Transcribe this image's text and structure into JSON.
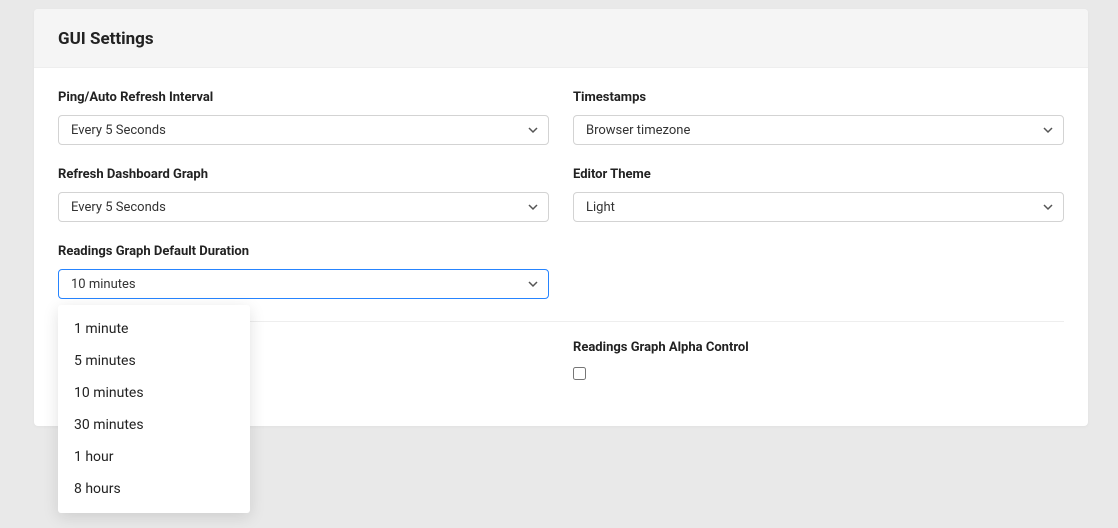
{
  "header": {
    "title": "GUI Settings"
  },
  "fields": {
    "ping_interval": {
      "label": "Ping/Auto Refresh Interval",
      "value": "Every 5 Seconds"
    },
    "refresh_graph": {
      "label": "Refresh Dashboard Graph",
      "value": "Every 5 Seconds"
    },
    "readings_duration": {
      "label": "Readings Graph Default Duration",
      "value": "10 minutes"
    },
    "timestamps": {
      "label": "Timestamps",
      "value": "Browser timezone"
    },
    "editor_theme": {
      "label": "Editor Theme",
      "value": "Light"
    }
  },
  "readings_duration_options": [
    "1 minute",
    "5 minutes",
    "10 minutes",
    "30 minutes",
    "1 hour",
    "8 hours"
  ],
  "checkboxes": {
    "left": {
      "label": ""
    },
    "alpha": {
      "label": "Readings Graph Alpha Control"
    }
  }
}
